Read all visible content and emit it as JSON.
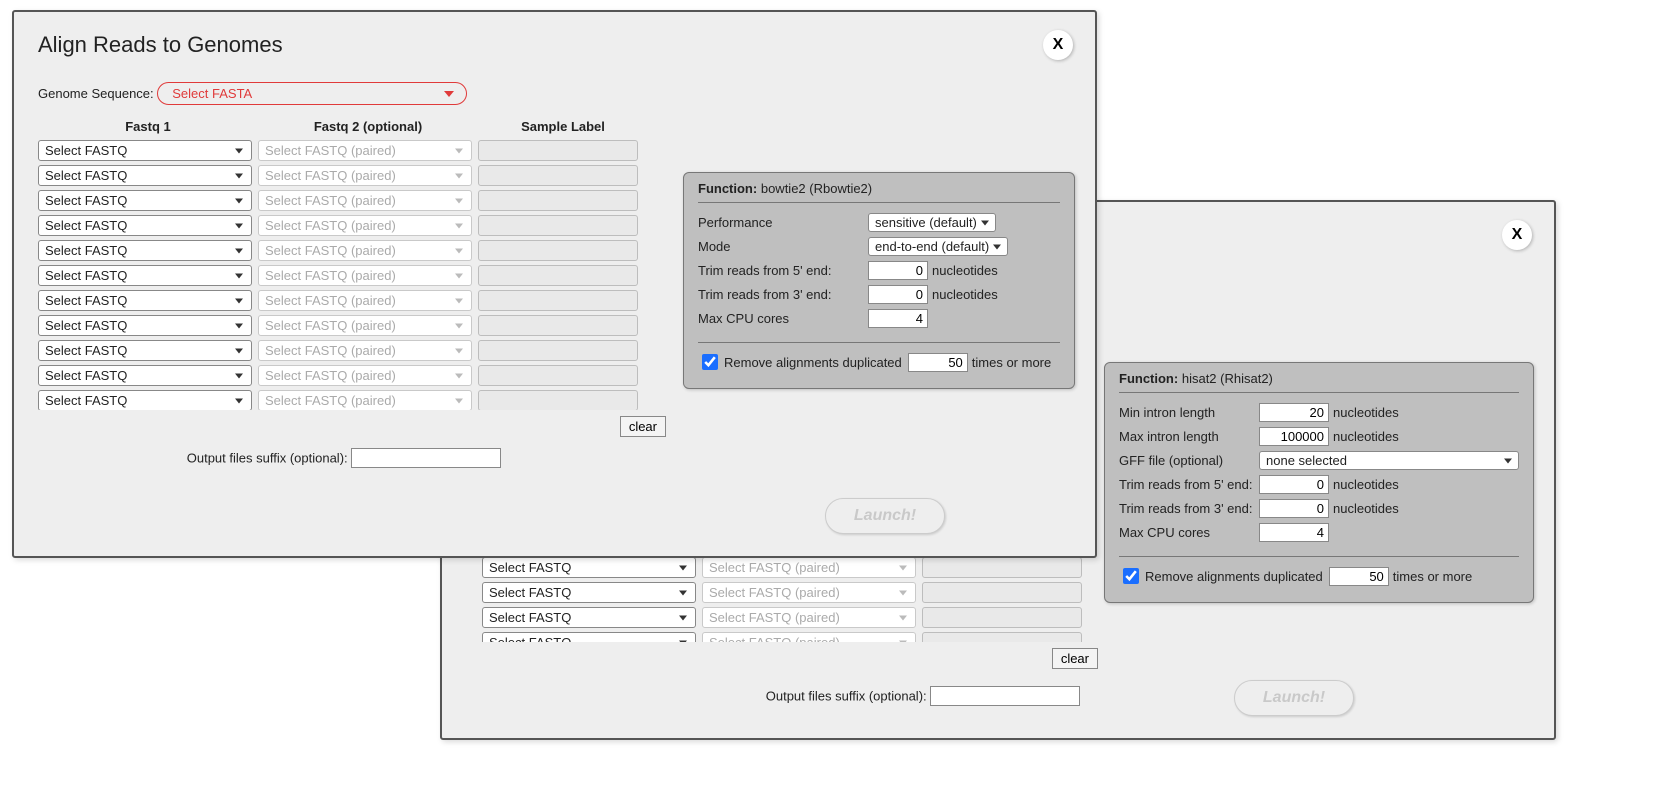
{
  "dialog_a": {
    "title": "Align Reads to Genomes",
    "close": "X",
    "genome_seq_label": "Genome Sequence:",
    "genome_seq_value": "Select FASTA",
    "cols": {
      "c1": "Fastq 1",
      "c2": "Fastq 2 (optional)",
      "c3": "Sample Label"
    },
    "fastq1_option": "Select FASTQ",
    "fastq2_option": "Select FASTQ (paired)",
    "clear": "clear",
    "suffix_label": "Output files suffix (optional):",
    "launch": "Launch!",
    "panel": {
      "func_label": "Function:",
      "func_name": "bowtie2 (Rbowtie2)",
      "perf_label": "Performance",
      "perf_value": "sensitive (default)",
      "mode_label": "Mode",
      "mode_value": "end-to-end (default)",
      "trim5_label": "Trim reads from 5' end:",
      "trim5_value": "0",
      "trim3_label": "Trim reads from 3' end:",
      "trim3_value": "0",
      "cores_label": "Max CPU cores",
      "cores_value": "4",
      "nt": "nucleotides",
      "dup_remove": "Remove alignments duplicated",
      "dup_value": "50",
      "dup_suffix": "times or more"
    }
  },
  "dialog_b": {
    "close": "X",
    "fastq1_option": "Select FASTQ",
    "fastq2_option": "Select FASTQ (paired)",
    "clear": "clear",
    "suffix_label": "Output files suffix (optional):",
    "launch": "Launch!",
    "panel": {
      "func_label": "Function:",
      "func_name": "hisat2 (Rhisat2)",
      "min_intron_label": "Min intron length",
      "min_intron_value": "20",
      "max_intron_label": "Max intron length",
      "max_intron_value": "100000",
      "gff_label": "GFF file (optional)",
      "gff_value": "none selected",
      "trim5_label": "Trim reads from 5' end:",
      "trim5_value": "0",
      "trim3_label": "Trim reads from 3' end:",
      "trim3_value": "0",
      "cores_label": "Max CPU cores",
      "cores_value": "4",
      "nt": "nucleotides",
      "dup_remove": "Remove alignments duplicated",
      "dup_value": "50",
      "dup_suffix": "times or more"
    }
  }
}
